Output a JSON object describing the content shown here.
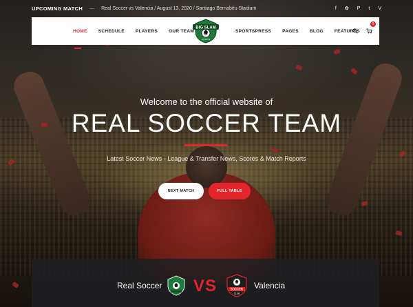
{
  "topbar": {
    "upcoming_label": "UPCOMING MATCH",
    "dash": "—",
    "match_info": "Real Soccer vs Valencia / August 13, 2020 / Santiago Bernabéu Stadium",
    "socials": [
      "f",
      "✿",
      "P",
      "t",
      "V"
    ]
  },
  "nav": {
    "left": [
      "HOME",
      "SCHEDULE",
      "PLAYERS",
      "OUR TEAM"
    ],
    "right": [
      "SPORTSPRESS",
      "PAGES",
      "BLOG",
      "FEATURES"
    ],
    "logo_text": "BIG SLAM",
    "logo_sub": "SPORTS",
    "cart_count": "0"
  },
  "hero": {
    "welcome": "Welcome to the official website of",
    "title": "REAL SOCCER TEAM",
    "subtitle": "Latest Soccer News - League & Transfer News, Scores & Match Reports",
    "btn_next": "NEXT MATCH",
    "btn_table": "FULL TABLE"
  },
  "match": {
    "home": "Real Soccer",
    "vs": "VS",
    "away": "Valencia",
    "away_crest_text": "SOCCER",
    "away_crest_sub": "CLUB"
  },
  "colors": {
    "accent": "#e2262b"
  }
}
